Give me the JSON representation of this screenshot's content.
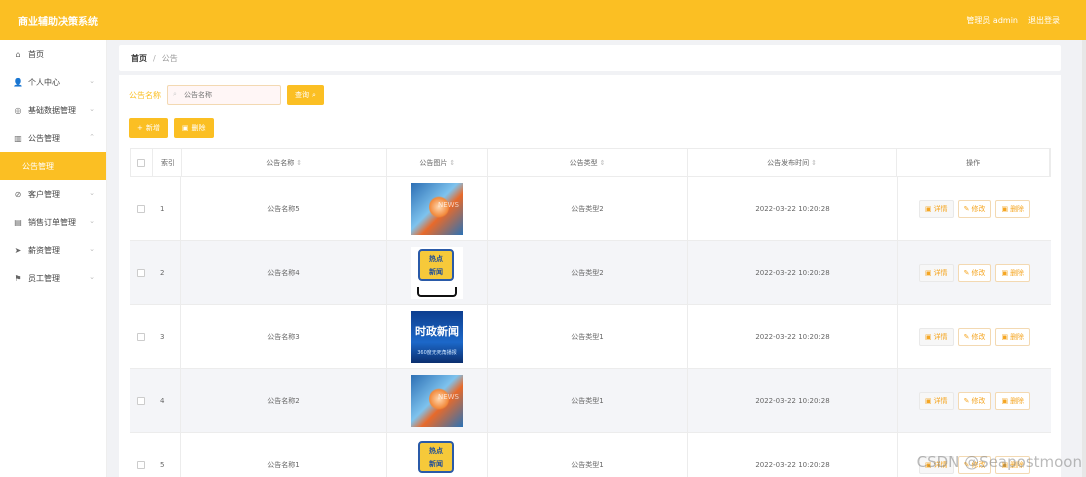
{
  "header": {
    "title": "商业辅助决策系统",
    "user": "管理员 admin",
    "logout": "退出登录"
  },
  "sidebar": {
    "items": [
      {
        "label": "首页",
        "icon": "home-icon",
        "glyph": "⌂",
        "chevron": ""
      },
      {
        "label": "个人中心",
        "icon": "user-icon",
        "glyph": "👤",
        "chevron": "⌄"
      },
      {
        "label": "基础数据管理",
        "icon": "settings-icon",
        "glyph": "◎",
        "chevron": "⌄"
      },
      {
        "label": "公告管理",
        "icon": "chart-icon",
        "glyph": "▥",
        "chevron": "⌃"
      },
      {
        "label": "公告管理",
        "icon": "",
        "glyph": "",
        "chevron": ""
      },
      {
        "label": "客户管理",
        "icon": "compass-icon",
        "glyph": "⊘",
        "chevron": "⌄"
      },
      {
        "label": "销售订单管理",
        "icon": "trash-icon",
        "glyph": "▤",
        "chevron": "⌄"
      },
      {
        "label": "薪资管理",
        "icon": "send-icon",
        "glyph": "➤",
        "chevron": "⌄"
      },
      {
        "label": "员工管理",
        "icon": "flag-icon",
        "glyph": "⚑",
        "chevron": "⌄"
      }
    ]
  },
  "breadcrumb": {
    "home": "首页",
    "separator": "/",
    "current": "公告"
  },
  "search": {
    "label": "公告名称",
    "placeholder": "公告名称",
    "button": "查询"
  },
  "actions": {
    "add": "新增",
    "delete": "删除"
  },
  "table": {
    "headers": {
      "index": "索引",
      "name": "公告名称",
      "image": "公告图片",
      "type": "公告类型",
      "time": "公告发布时间",
      "ops": "操作"
    },
    "ops": {
      "detail": "详情",
      "edit": "修改",
      "remove": "删除"
    },
    "rows": [
      {
        "index": "1",
        "name": "公告名称5",
        "image": "news",
        "type": "公告类型2",
        "time": "2022-03-22 10:20:28"
      },
      {
        "index": "2",
        "name": "公告名称4",
        "image": "hot",
        "type": "公告类型2",
        "time": "2022-03-22 10:20:28"
      },
      {
        "index": "3",
        "name": "公告名称3",
        "image": "politics",
        "type": "公告类型1",
        "time": "2022-03-22 10:20:28"
      },
      {
        "index": "4",
        "name": "公告名称2",
        "image": "news",
        "type": "公告类型1",
        "time": "2022-03-22 10:20:28"
      },
      {
        "index": "5",
        "name": "公告名称1",
        "image": "hot",
        "type": "公告类型1",
        "time": "2022-03-22 10:20:28"
      }
    ]
  },
  "images": {
    "news": {
      "text": "NEWS"
    },
    "hot": {
      "line1": "热点",
      "line2": "新闻"
    },
    "politics": {
      "big": "时政新闻",
      "small": "360度无死角播报"
    }
  },
  "watermark": "CSDN @Seapostmoon",
  "colors": {
    "brand": "#fbbf23"
  }
}
